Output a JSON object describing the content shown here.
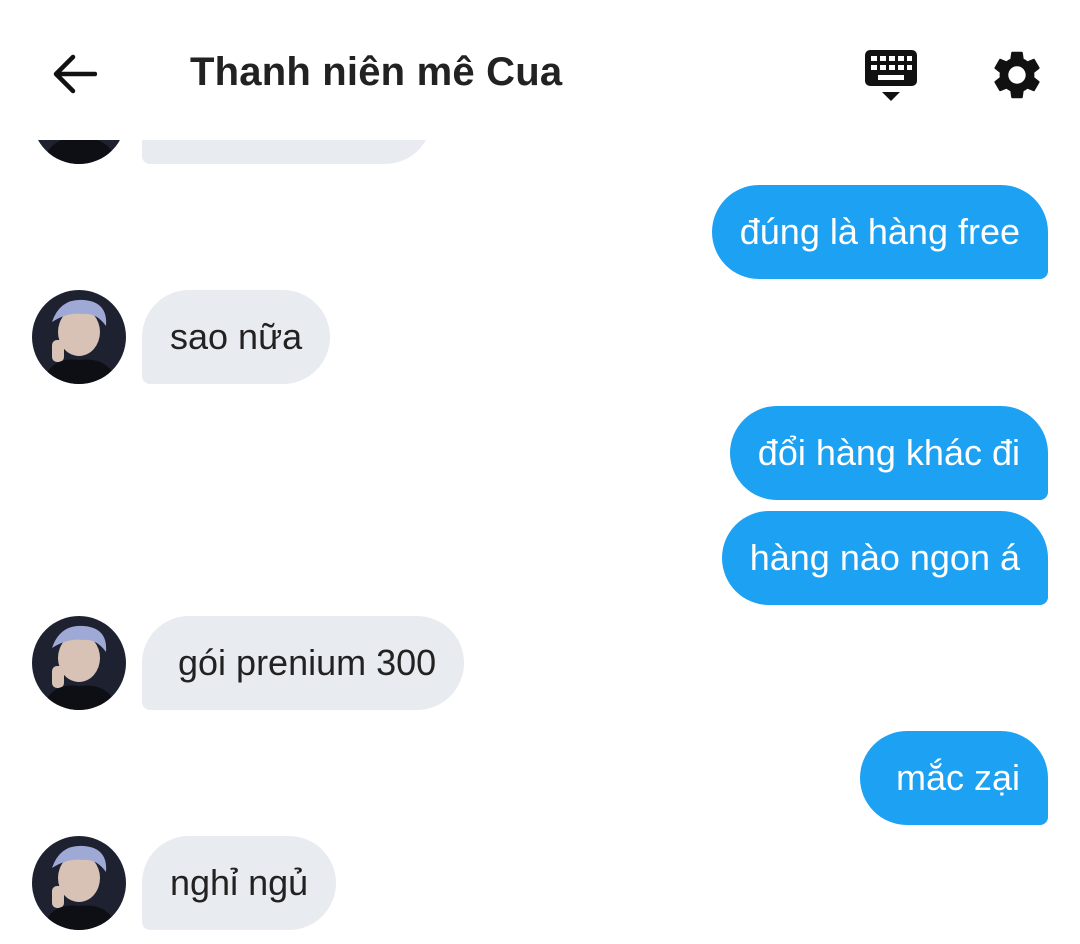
{
  "header": {
    "title": "Thanh niên mê Cua",
    "back_icon": "arrow-left-icon",
    "keyboard_icon": "keyboard-hide-icon",
    "settings_icon": "gear-icon"
  },
  "colors": {
    "outgoing_bubble": "#1da1f2",
    "incoming_bubble": "#e8ebef",
    "text_dark": "#222222"
  },
  "messages": [
    {
      "direction": "incoming",
      "text": "",
      "avatar": true
    },
    {
      "direction": "outgoing",
      "text": "đúng là hàng free"
    },
    {
      "direction": "incoming",
      "text": "sao nữa",
      "avatar": true
    },
    {
      "direction": "outgoing",
      "text": "đổi hàng khác đi"
    },
    {
      "direction": "outgoing",
      "text": "hàng nào ngon á"
    },
    {
      "direction": "incoming",
      "text": "gói prenium 300",
      "avatar": true
    },
    {
      "direction": "outgoing",
      "text": "mắc zại"
    },
    {
      "direction": "incoming",
      "text": "nghỉ ngủ",
      "avatar": true
    }
  ]
}
